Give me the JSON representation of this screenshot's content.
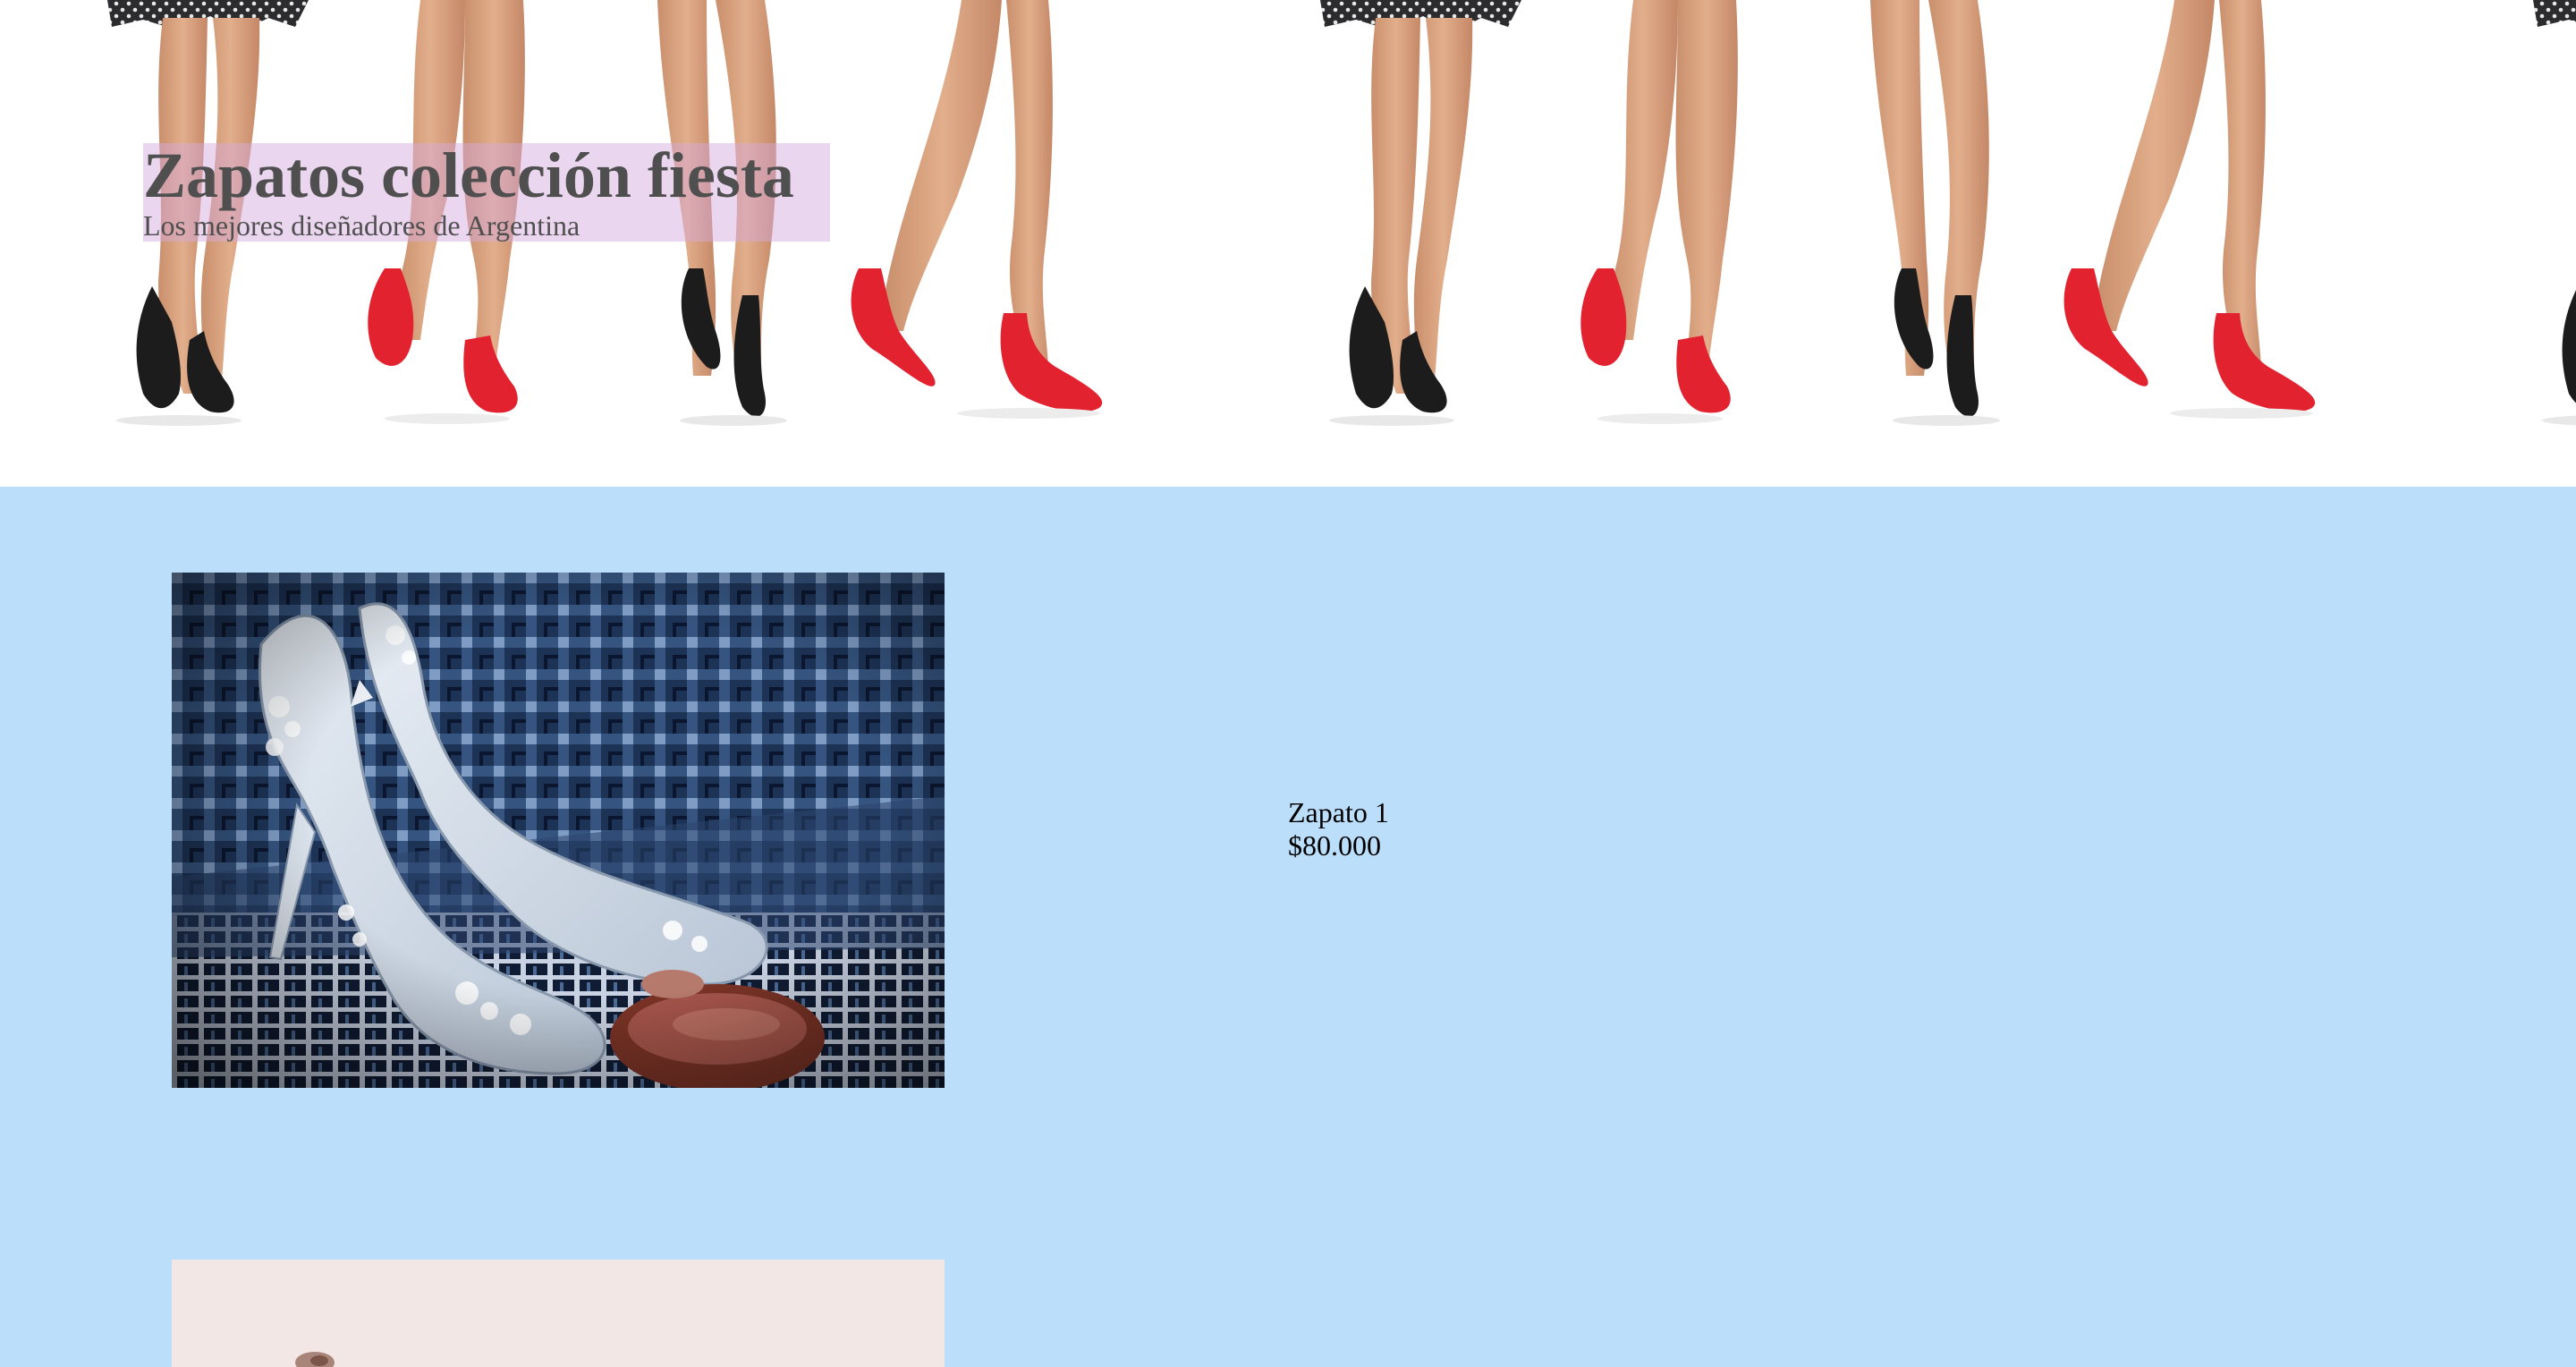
{
  "header": {
    "title": "Zapatos colección fiesta",
    "subtitle": "Los mejores diseñadores de Argentina"
  },
  "products": [
    {
      "name": "Zapato 1",
      "price": "$80.000",
      "image": "white-lace-heels-photo"
    },
    {
      "image": "pink-background-shoe-photo"
    }
  ],
  "colors": {
    "page_background": "#bbdefa",
    "hero_background": "#ffffff",
    "title_highlight": "#d6aade",
    "title_text": "#4f4f4f",
    "heel_red": "#e3222f",
    "heel_black": "#1c1c1c"
  }
}
